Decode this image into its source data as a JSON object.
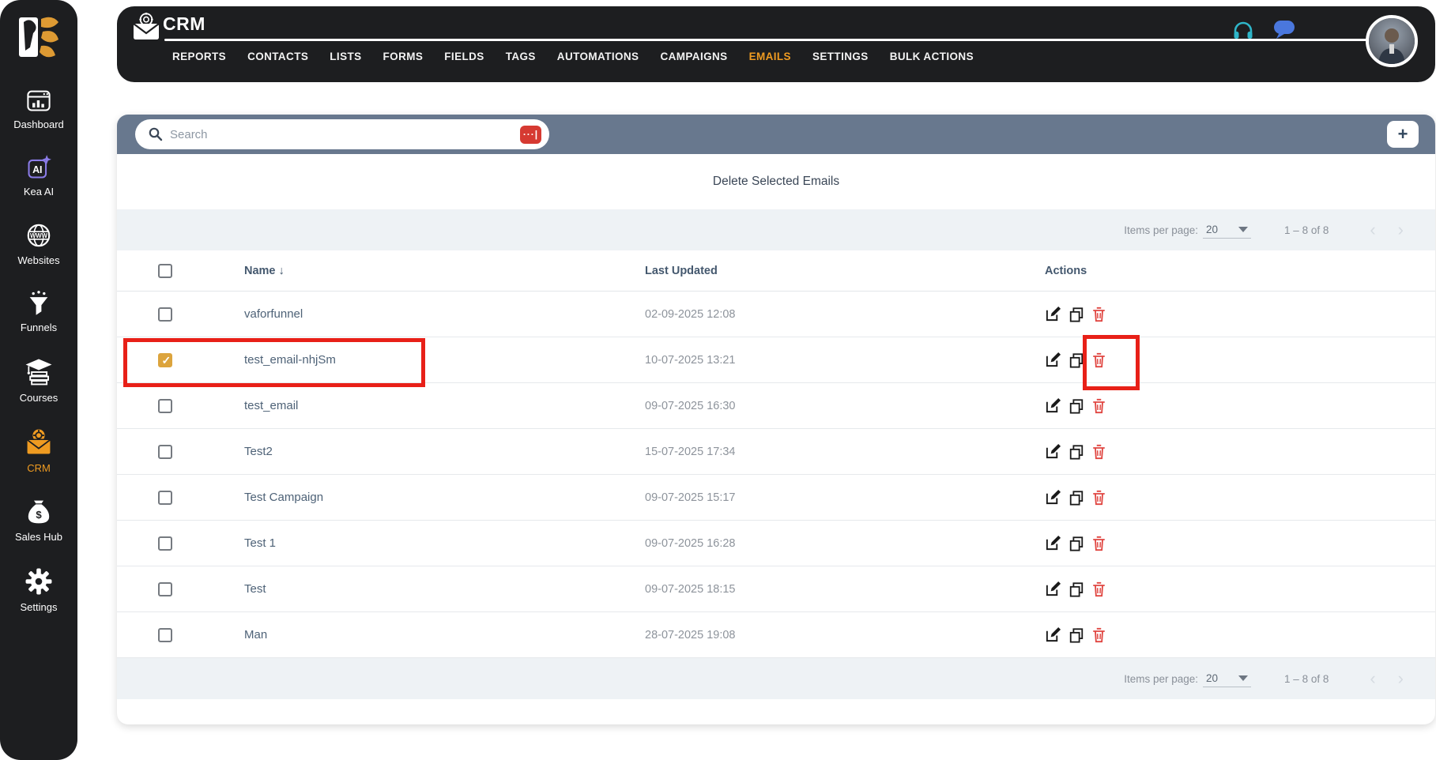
{
  "app": {
    "title": "CRM"
  },
  "sidebar": {
    "items": [
      {
        "label": "Dashboard",
        "icon": "dashboard-icon",
        "active": false
      },
      {
        "label": "Kea AI",
        "icon": "kea-ai-icon",
        "active": false
      },
      {
        "label": "Websites",
        "icon": "websites-icon",
        "active": false
      },
      {
        "label": "Funnels",
        "icon": "funnels-icon",
        "active": false
      },
      {
        "label": "Courses",
        "icon": "courses-icon",
        "active": false
      },
      {
        "label": "CRM",
        "icon": "crm-icon",
        "active": true
      },
      {
        "label": "Sales Hub",
        "icon": "sales-hub-icon",
        "active": false
      },
      {
        "label": "Settings",
        "icon": "settings-icon",
        "active": false
      }
    ]
  },
  "nav": {
    "items": [
      {
        "label": "REPORTS",
        "active": false
      },
      {
        "label": "CONTACTS",
        "active": false
      },
      {
        "label": "LISTS",
        "active": false
      },
      {
        "label": "FORMS",
        "active": false
      },
      {
        "label": "FIELDS",
        "active": false
      },
      {
        "label": "TAGS",
        "active": false
      },
      {
        "label": "AUTOMATIONS",
        "active": false
      },
      {
        "label": "CAMPAIGNS",
        "active": false
      },
      {
        "label": "EMAILS",
        "active": true
      },
      {
        "label": "SETTINGS",
        "active": false
      },
      {
        "label": "BULK ACTIONS",
        "active": false
      }
    ]
  },
  "toolbar": {
    "search_placeholder": "Search",
    "extension_chip": "···|",
    "add_button": "+"
  },
  "bulk_bar": {
    "delete_selected_label": "Delete Selected Emails"
  },
  "pagination": {
    "items_per_page_label": "Items per page:",
    "items_per_page_value": "20",
    "range": "1 – 8 of 8",
    "prev": "‹",
    "next": "›"
  },
  "table": {
    "headers": {
      "name": "Name",
      "sort_indicator": "↓",
      "last_updated": "Last Updated",
      "actions": "Actions"
    },
    "rows": [
      {
        "name": "vaforfunnel",
        "updated": "02-09-2025 12:08",
        "checked": false,
        "annotate_name": false,
        "annotate_delete": false
      },
      {
        "name": "test_email-nhjSm",
        "updated": "10-07-2025 13:21",
        "checked": true,
        "annotate_name": true,
        "annotate_delete": true
      },
      {
        "name": "test_email",
        "updated": "09-07-2025 16:30",
        "checked": false,
        "annotate_name": false,
        "annotate_delete": false
      },
      {
        "name": "Test2",
        "updated": "15-07-2025 17:34",
        "checked": false,
        "annotate_name": false,
        "annotate_delete": false
      },
      {
        "name": "Test Campaign",
        "updated": "09-07-2025 15:17",
        "checked": false,
        "annotate_name": false,
        "annotate_delete": false
      },
      {
        "name": "Test 1",
        "updated": "09-07-2025 16:28",
        "checked": false,
        "annotate_name": false,
        "annotate_delete": false
      },
      {
        "name": "Test",
        "updated": "09-07-2025 18:15",
        "checked": false,
        "annotate_name": false,
        "annotate_delete": false
      },
      {
        "name": "Man",
        "updated": "28-07-2025 19:08",
        "checked": false,
        "annotate_name": false,
        "annotate_delete": false
      }
    ]
  },
  "colors": {
    "accent_orange": "#ef9b21",
    "dark": "#1d1e20",
    "toolbar_slate": "#68788e",
    "annotation_red": "#e82018",
    "chip_red": "#d63a32",
    "checked_gold": "#dca43d",
    "trash_red": "#e04540",
    "headset_teal": "#2fb6c9",
    "chat_blue": "#4a77dd"
  }
}
